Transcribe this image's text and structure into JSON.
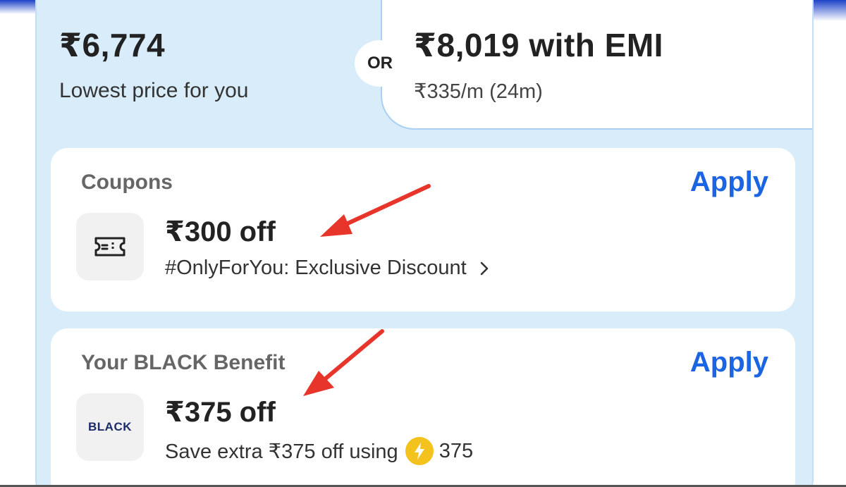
{
  "price": {
    "amount": "₹6,774",
    "label": "Lowest price for you"
  },
  "separator": "OR",
  "emi": {
    "amount": "₹8,019 with EMI",
    "monthly": "₹335/m (24m)"
  },
  "coupons": {
    "title": "Coupons",
    "apply_label": "Apply",
    "icon": "ticket-icon",
    "offer_amount": "₹300 off",
    "offer_desc": "#OnlyForYou: Exclusive Discount"
  },
  "black_benefit": {
    "title": "Your BLACK Benefit",
    "apply_label": "Apply",
    "logo_text": "BLACK",
    "offer_amount": "₹375 off",
    "desc_prefix": "Save extra ₹375 off using",
    "coins_icon": "lightning-coin-icon",
    "coins_value": "375"
  },
  "colors": {
    "accent": "#1b65e3",
    "panel_bg": "#d8ecfa",
    "annotation_arrow": "#e8352b",
    "coin": "#f4c21d"
  }
}
